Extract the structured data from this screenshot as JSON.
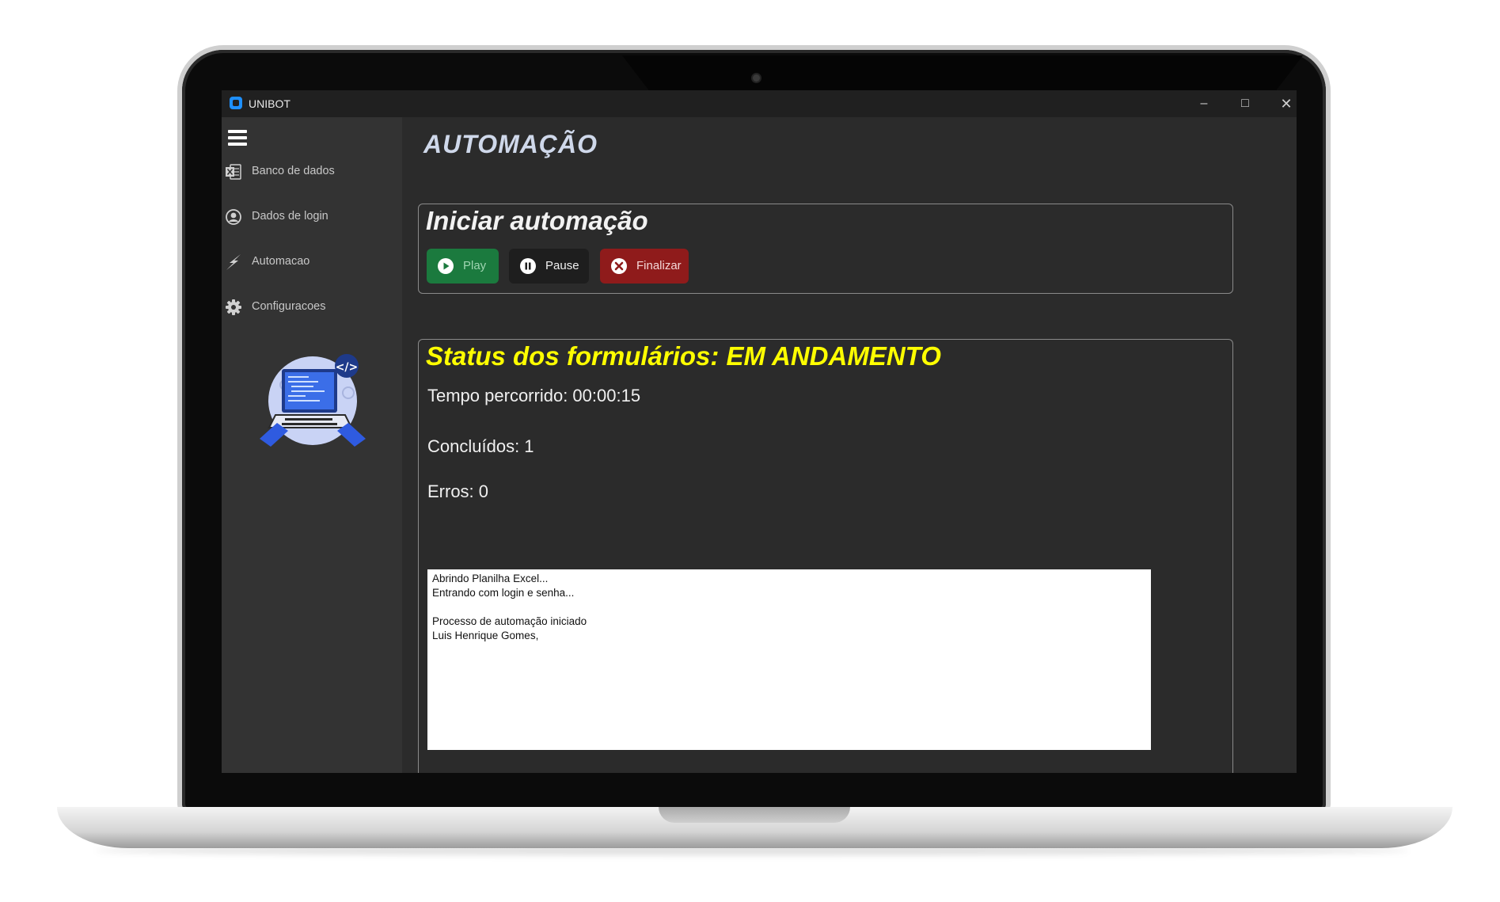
{
  "window": {
    "app_title": "UNIBOT",
    "minimize_icon": "minimize-icon",
    "maximize_icon": "maximize-icon",
    "close_icon": "close-icon"
  },
  "sidebar": {
    "menu_icon": "hamburger-menu-icon",
    "items": [
      {
        "label": "Banco de dados",
        "icon": "excel-icon"
      },
      {
        "label": "Dados de login",
        "icon": "user-circle-icon"
      },
      {
        "label": "Automacao",
        "icon": "lightning-icon"
      },
      {
        "label": "Configuracoes",
        "icon": "gear-icon"
      }
    ],
    "illustration": "developer-laptop-illustration"
  },
  "main": {
    "title": "AUTOMAÇÃO",
    "start_panel": {
      "title": "Iniciar automação",
      "buttons": {
        "play": "Play",
        "pause": "Pause",
        "finalize": "Finalizar"
      }
    },
    "status_panel": {
      "title": "Status dos formulários: EM ANDAMENTO",
      "elapsed": "Tempo percorrido: 00:00:15",
      "completed": "Concluídos: 1",
      "errors": "Erros: 0",
      "log_lines": [
        "Abrindo Planilha Excel...",
        "Entrando com login e senha...",
        "",
        "Processo de automação iniciado",
        "Luis Henrique Gomes,"
      ]
    }
  },
  "colors": {
    "status_yellow": "#ffff00",
    "play_green": "#1b7a3e",
    "stop_red": "#8f1b1b",
    "title_blue": "#1e90ff"
  }
}
